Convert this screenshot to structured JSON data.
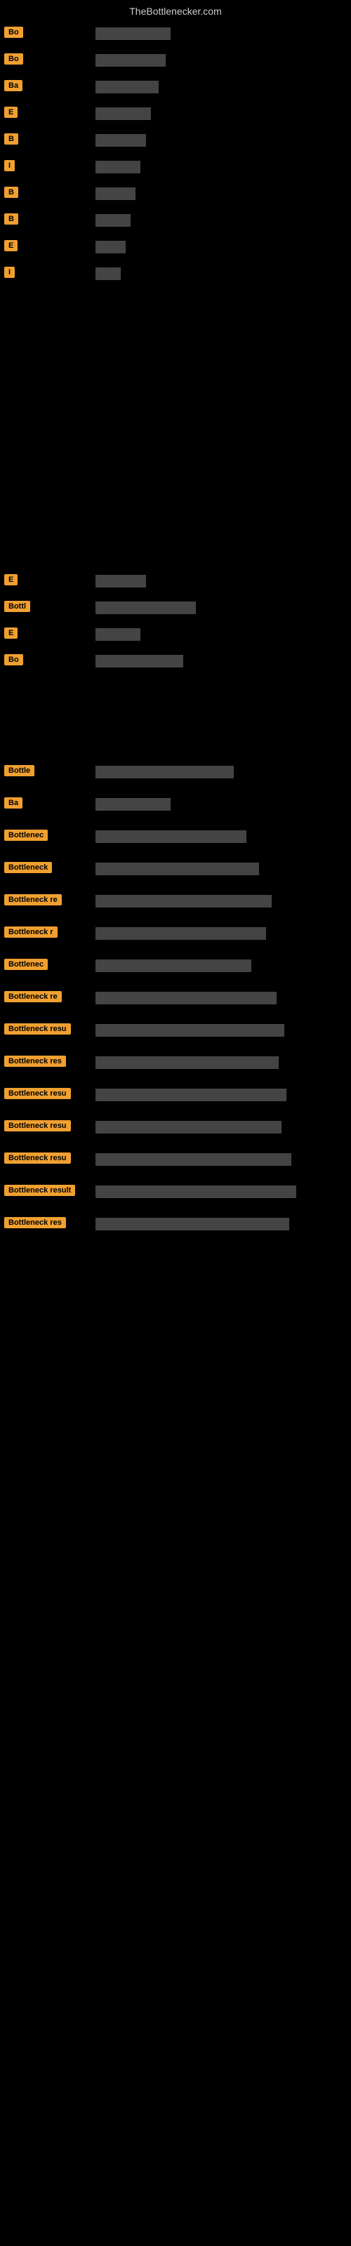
{
  "site": {
    "title": "TheBottlenecker.com"
  },
  "rows": [
    {
      "id": 1,
      "label": "Bo",
      "bar_width": "30%"
    },
    {
      "id": 2,
      "label": "Bo",
      "bar_width": "28%"
    },
    {
      "id": 3,
      "label": "Ba",
      "bar_width": "25%"
    },
    {
      "id": 4,
      "label": "E",
      "bar_width": "22%"
    },
    {
      "id": 5,
      "label": "B",
      "bar_width": "20%"
    },
    {
      "id": 6,
      "label": "I",
      "bar_width": "18%"
    },
    {
      "id": 7,
      "label": "B",
      "bar_width": "16%"
    },
    {
      "id": 8,
      "label": "B",
      "bar_width": "14%"
    },
    {
      "id": 9,
      "label": "E",
      "bar_width": "12%"
    },
    {
      "id": 10,
      "label": "I",
      "bar_width": "10%"
    }
  ],
  "lower_rows": [
    {
      "id": 11,
      "label": "E",
      "bar_width": "20%"
    },
    {
      "id": 12,
      "label": "Bottl",
      "bar_width": "40%"
    },
    {
      "id": 13,
      "label": "E",
      "bar_width": "18%"
    },
    {
      "id": 14,
      "label": "Bo",
      "bar_width": "35%"
    }
  ],
  "bottom_rows": [
    {
      "id": 15,
      "label": "Bottle",
      "bar_width": "55%"
    },
    {
      "id": 16,
      "label": "Ba",
      "bar_width": "30%"
    },
    {
      "id": 17,
      "label": "Bottlenec",
      "bar_width": "60%"
    },
    {
      "id": 18,
      "label": "Bottleneck",
      "bar_width": "65%"
    },
    {
      "id": 19,
      "label": "Bottleneck re",
      "bar_width": "70%"
    },
    {
      "id": 20,
      "label": "Bottleneck r",
      "bar_width": "68%"
    },
    {
      "id": 21,
      "label": "Bottlenec",
      "bar_width": "62%"
    },
    {
      "id": 22,
      "label": "Bottleneck re",
      "bar_width": "72%"
    },
    {
      "id": 23,
      "label": "Bottleneck resu",
      "bar_width": "75%"
    },
    {
      "id": 24,
      "label": "Bottleneck res",
      "bar_width": "73%"
    },
    {
      "id": 25,
      "label": "Bottleneck resu",
      "bar_width": "76%"
    },
    {
      "id": 26,
      "label": "Bottleneck resu",
      "bar_width": "74%"
    },
    {
      "id": 27,
      "label": "Bottleneck resu",
      "bar_width": "78%"
    },
    {
      "id": 28,
      "label": "Bottleneck result",
      "bar_width": "80%"
    },
    {
      "id": 29,
      "label": "Bottleneck res",
      "bar_width": "77%"
    }
  ]
}
